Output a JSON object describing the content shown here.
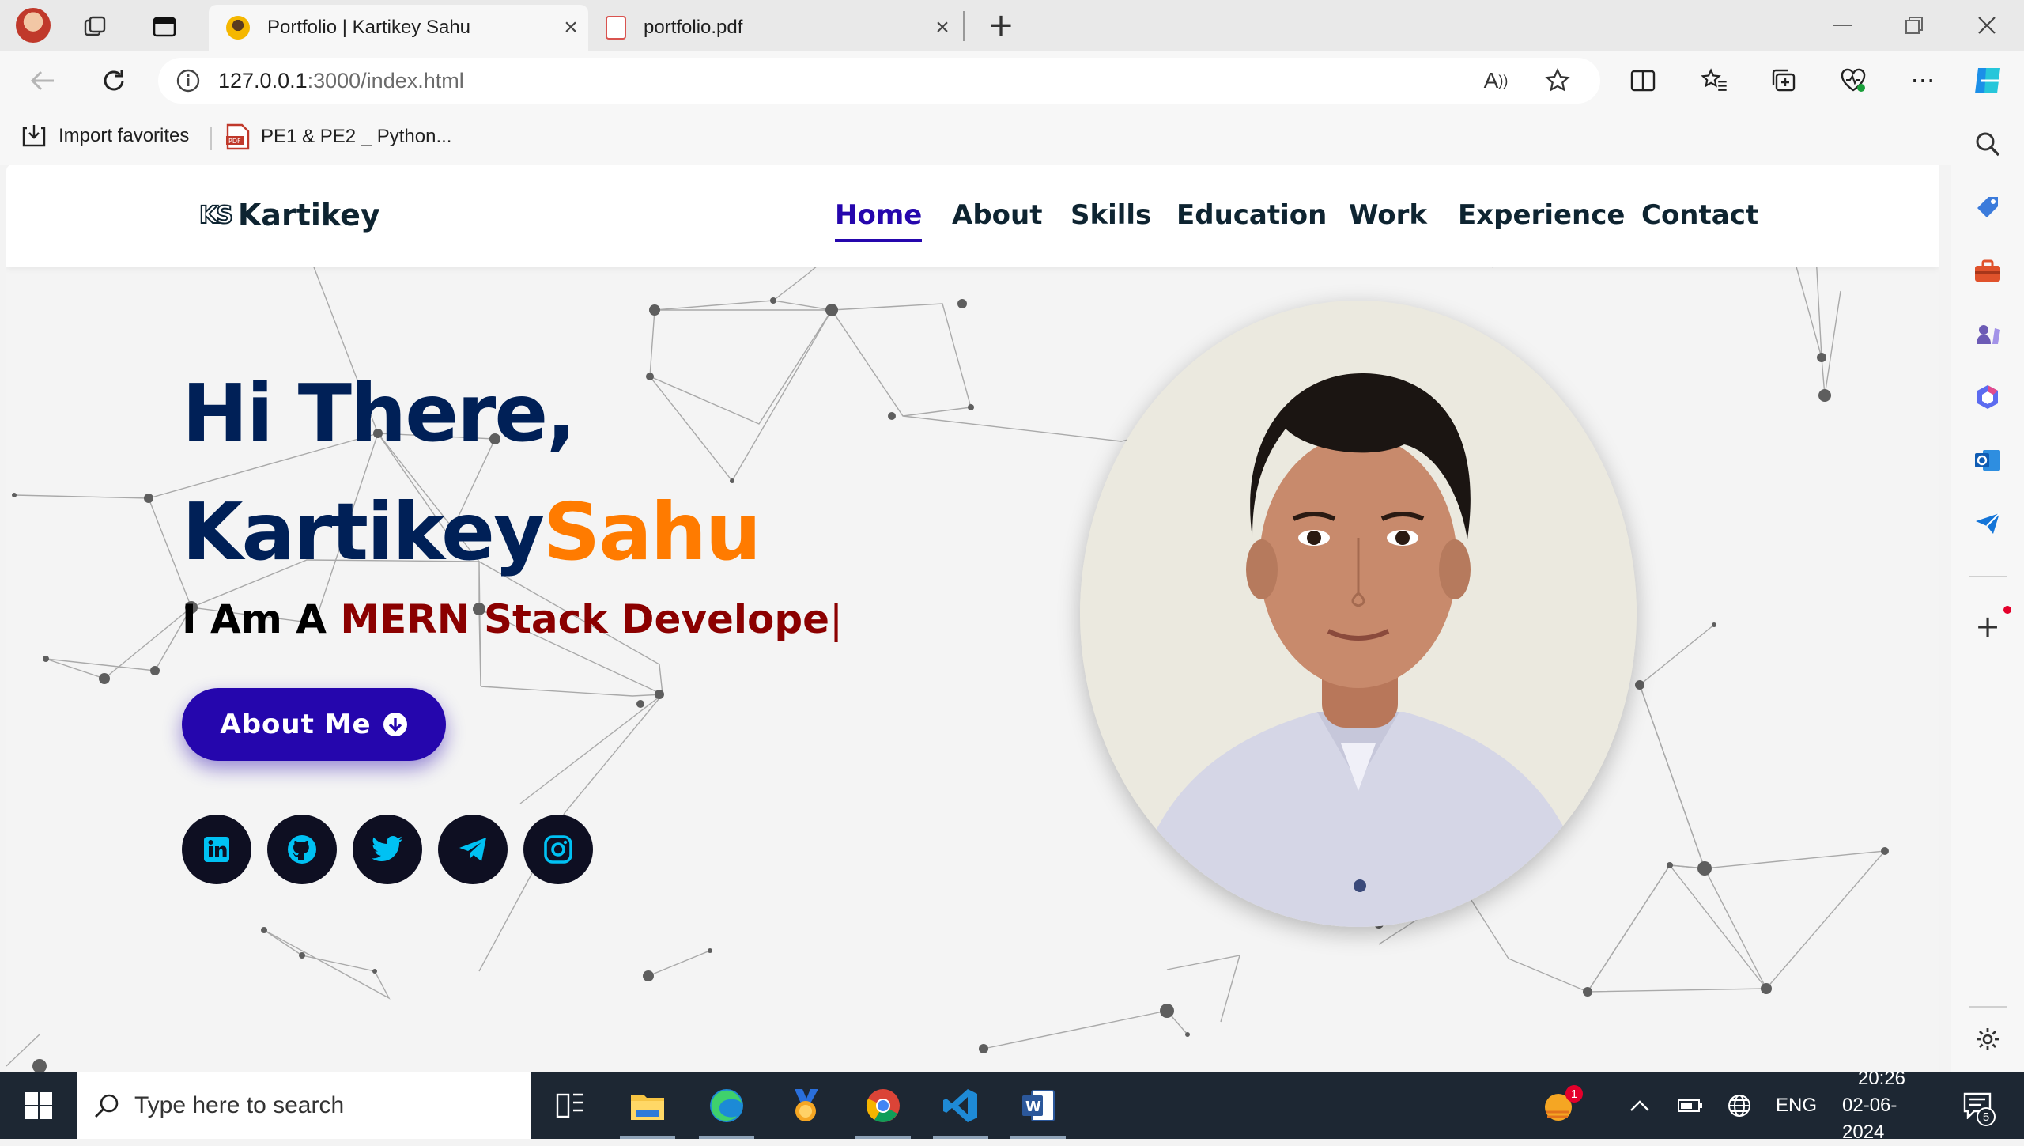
{
  "browser": {
    "tabs": [
      {
        "title": "Portfolio | Kartikey Sahu",
        "active": true
      },
      {
        "title": "portfolio.pdf",
        "active": false
      }
    ],
    "url_host": "127.0.0.1",
    "url_rest": ":3000/index.html",
    "favorites": [
      {
        "label": "Import favorites"
      },
      {
        "label": "PE1 & PE2 _ Python..."
      }
    ]
  },
  "site": {
    "logo_mark": "KS",
    "logo_text": "Kartikey",
    "nav": [
      "Home",
      "About",
      "Skills",
      "Education",
      "Work",
      "Experience",
      "Contact"
    ],
    "active_nav": "Home",
    "hero_line1": "Hi There,",
    "hero_first": "Kartikey",
    "hero_last": "Sahu",
    "typed_prefix": "I Am A ",
    "typed_role": "MERN Stack Develope",
    "typed_cursor": "|",
    "about_button": "About Me",
    "socials": [
      "linkedin-icon",
      "github-icon",
      "twitter-icon",
      "telegram-icon",
      "instagram-icon"
    ],
    "colors": {
      "navy": "#002057",
      "orange": "#ff7b00",
      "button": "#2506ad",
      "role": "#8b0000"
    }
  },
  "taskbar": {
    "search_placeholder": "Type here to search",
    "language": "ENG",
    "time": "20:26",
    "date": "02-06-2024",
    "notification_count": "5",
    "weather_badge": "1"
  }
}
